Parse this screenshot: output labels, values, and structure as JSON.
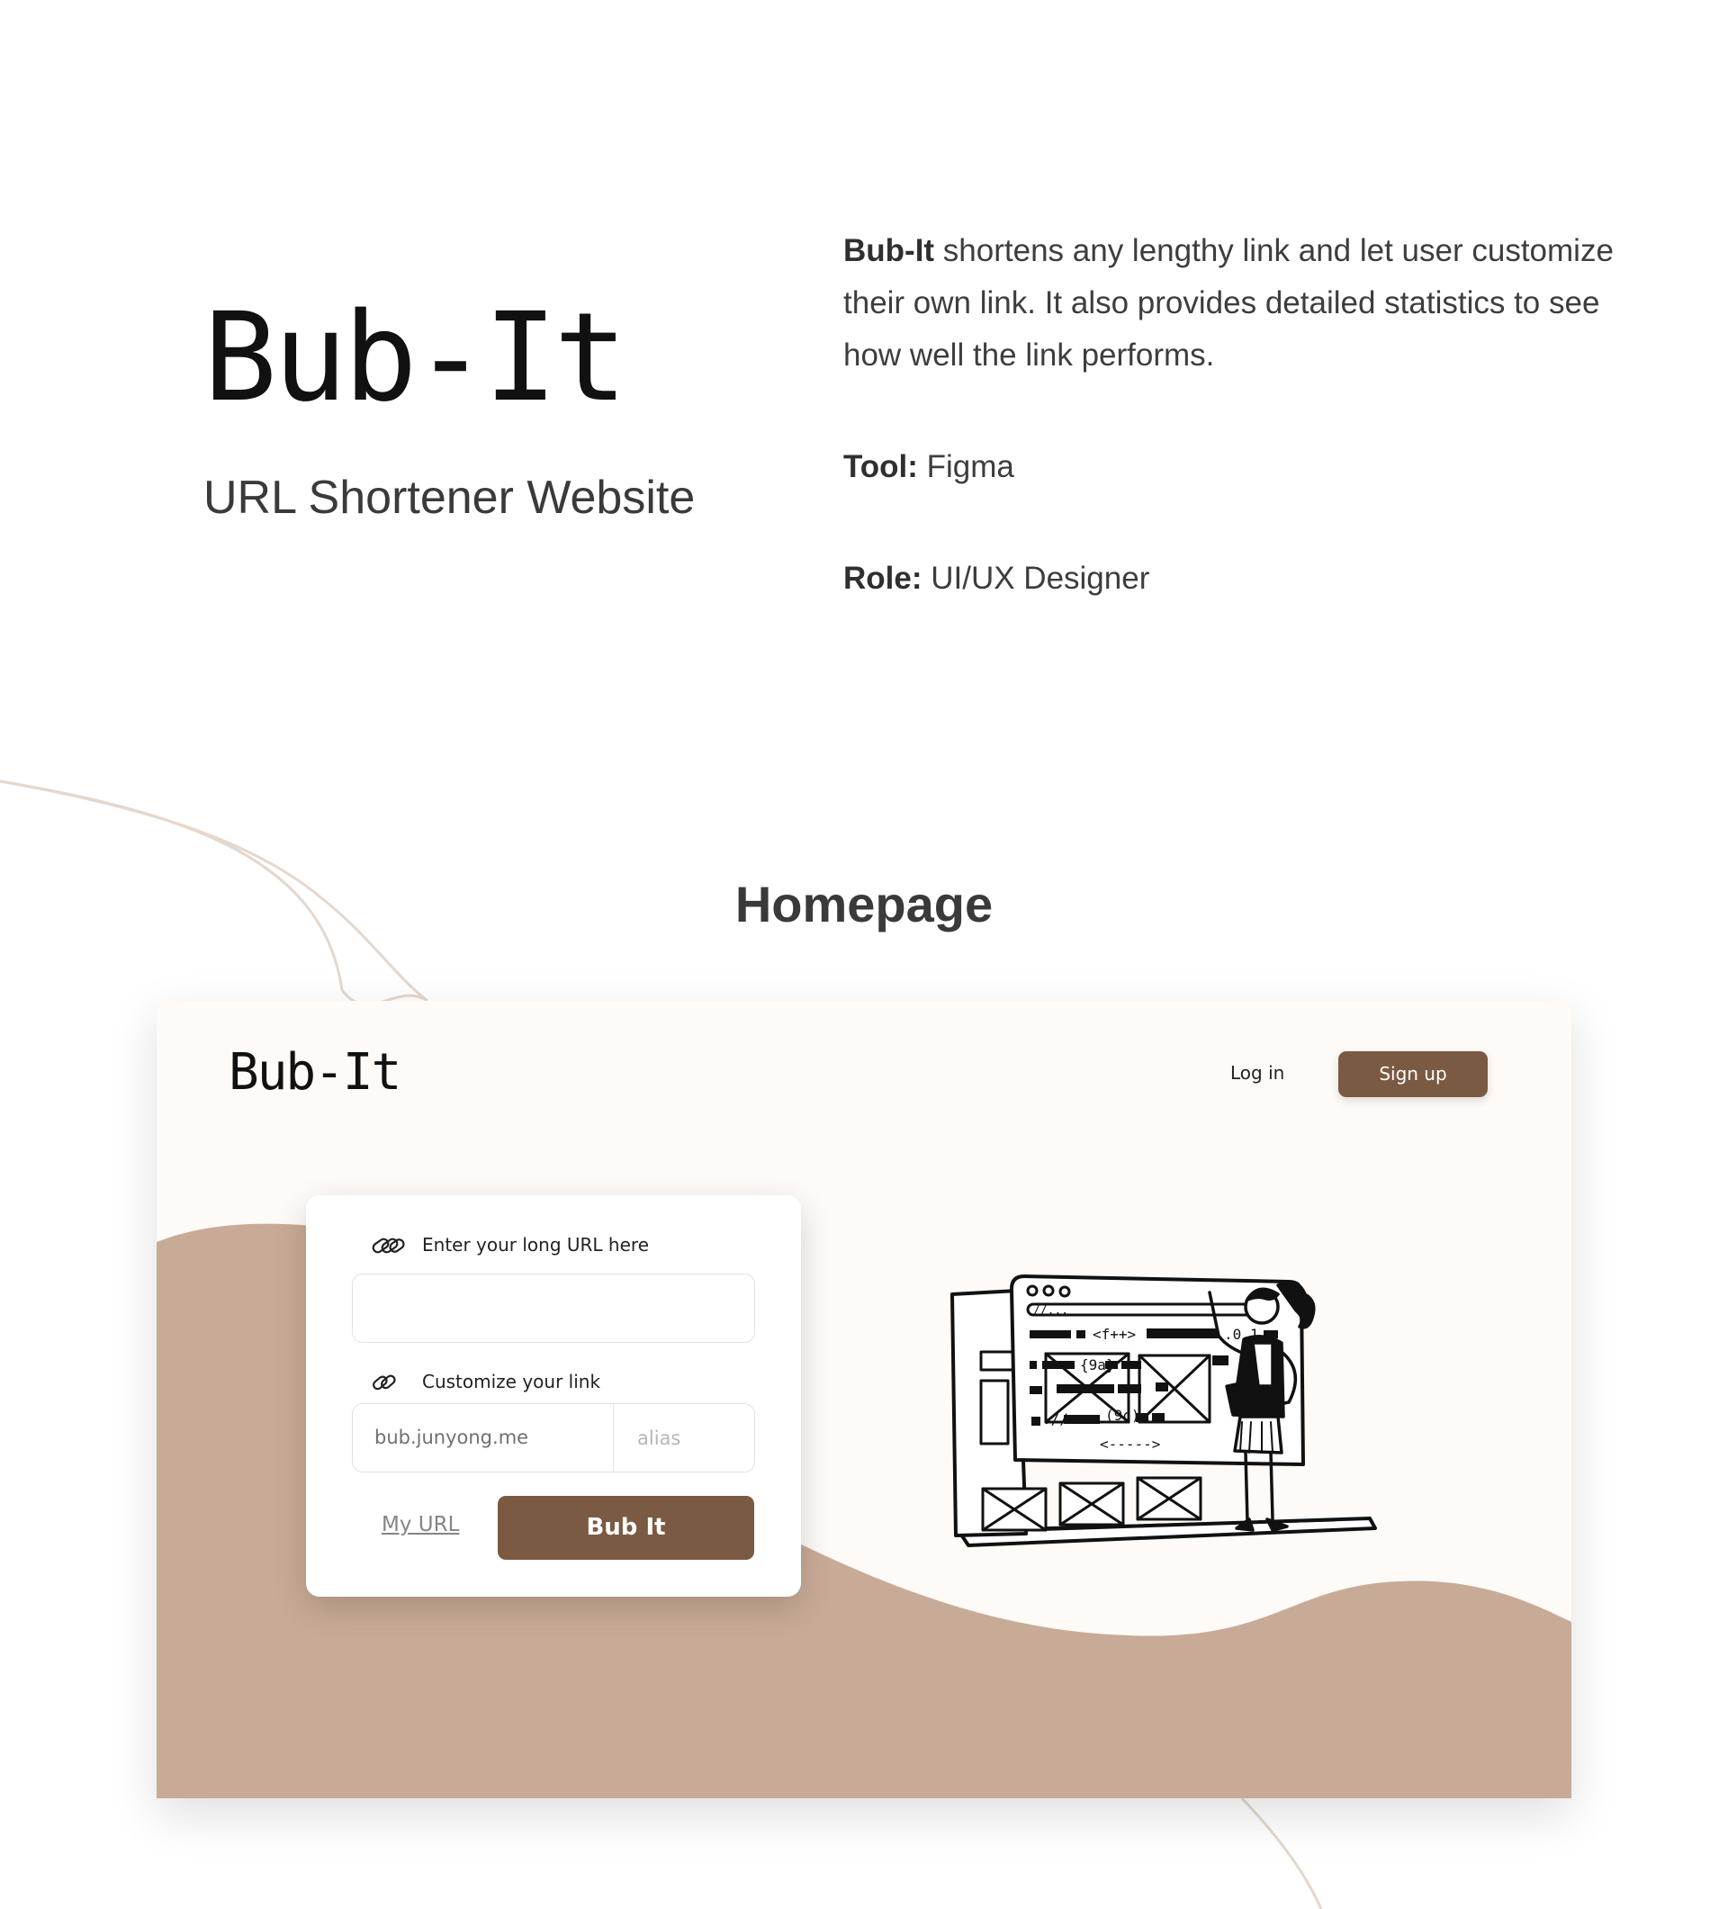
{
  "hero": {
    "logo": "Bub-It",
    "subtitle": "URL Shortener Website",
    "description_bold": "Bub-It",
    "description_rest": " shortens any lengthy link and let user customize their own link. It also provides detailed statistics to see how well the link performs.",
    "tool_label": "Tool:",
    "tool_value": " Figma",
    "role_label": "Role:",
    "role_value": " UI/UX Designer"
  },
  "section": {
    "title": "Homepage"
  },
  "mockup": {
    "logo": "Bub-It",
    "nav": {
      "login": "Log in",
      "signup": "Sign up"
    },
    "card": {
      "long_url_label": "Enter your long URL here",
      "customize_label": "Customize your link",
      "domain": "bub.junyong.me",
      "alias_placeholder": "alias",
      "my_url": "My URL",
      "submit": "Bub It"
    },
    "illustration": {
      "code_tokens": [
        "//...",
        "<f++>",
        ".0,1",
        "{9a}",
        "(9c)",
        "<-----> "
      ]
    }
  },
  "colors": {
    "brand_brown": "#7b5a43",
    "wave_tan": "#c8ab96",
    "mockup_bg": "#fdfaf7",
    "deco_line": "#e5d7cc"
  },
  "icons": [
    "chain-link-icon",
    "link-icon"
  ]
}
